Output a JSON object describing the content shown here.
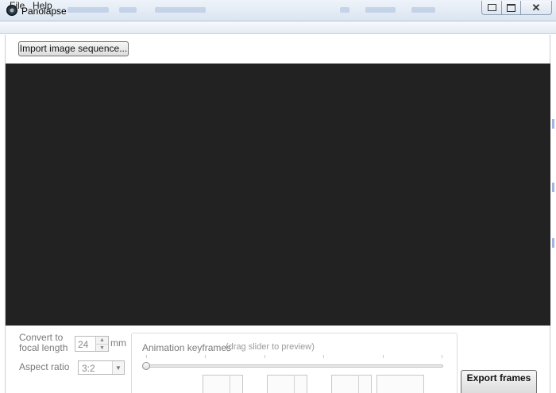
{
  "window": {
    "title": "Panolapse",
    "icon": "camera-lens-icon"
  },
  "menu": {
    "items": [
      "File",
      "Help"
    ]
  },
  "toolbar": {
    "import_label": "Import image sequence..."
  },
  "controls": {
    "convert_label": "Convert to focal length",
    "focal_value": "24",
    "focal_unit": "mm",
    "aspect_label": "Aspect ratio",
    "aspect_value": "3:2"
  },
  "keyframes": {
    "title": "Animation keyframes",
    "hint": "(drag slider to preview)",
    "slider_value": 0
  },
  "export": {
    "label": "Export frames"
  }
}
